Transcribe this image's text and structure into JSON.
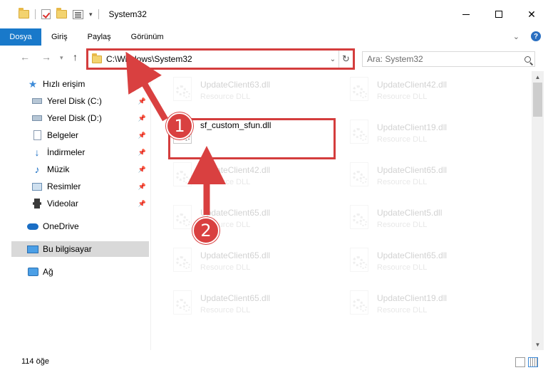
{
  "window": {
    "title": "System32"
  },
  "ribbon": {
    "tabs": [
      "Dosya",
      "Giriş",
      "Paylaş",
      "Görünüm"
    ]
  },
  "address_bar": {
    "path": "C:\\Windows\\System32"
  },
  "search": {
    "placeholder": "Ara: System32"
  },
  "sidebar": {
    "items": [
      {
        "label": "Hızlı erişim",
        "icon": "star-icon"
      },
      {
        "label": "Yerel Disk (C:)",
        "icon": "disk-icon",
        "pinned": true
      },
      {
        "label": "Yerel Disk (D:)",
        "icon": "disk-icon",
        "pinned": true
      },
      {
        "label": "Belgeler",
        "icon": "document-icon",
        "pinned": true
      },
      {
        "label": "İndirmeler",
        "icon": "download-icon",
        "pinned": true
      },
      {
        "label": "Müzik",
        "icon": "music-icon",
        "pinned": true
      },
      {
        "label": "Resimler",
        "icon": "picture-icon",
        "pinned": true
      },
      {
        "label": "Videolar",
        "icon": "video-icon",
        "pinned": true
      },
      {
        "label": "OneDrive",
        "icon": "cloud-icon"
      },
      {
        "label": "Bu bilgisayar",
        "icon": "computer-icon",
        "selected": true
      },
      {
        "label": "Ağ",
        "icon": "network-icon"
      }
    ]
  },
  "files": [
    {
      "name": "UpdateClient63.dll",
      "type": "Resource DLL",
      "faded": true
    },
    {
      "name": "UpdateClient42.dll",
      "type": "Resource DLL",
      "faded": true
    },
    {
      "name": "sf_custom_sfun.dll",
      "type": "",
      "faded": false,
      "highlighted": true
    },
    {
      "name": "UpdateClient19.dll",
      "type": "Resource DLL",
      "faded": true
    },
    {
      "name": "UpdateClient42.dll",
      "type": "Resource DLL",
      "faded": true
    },
    {
      "name": "UpdateClient65.dll",
      "type": "Resource DLL",
      "faded": true
    },
    {
      "name": "UpdateClient65.dll",
      "type": "Resource DLL",
      "faded": true
    },
    {
      "name": "UpdateClient5.dll",
      "type": "Resource DLL",
      "faded": true
    },
    {
      "name": "UpdateClient65.dll",
      "type": "Resource DLL",
      "faded": true
    },
    {
      "name": "UpdateClient65.dll",
      "type": "Resource DLL",
      "faded": true
    },
    {
      "name": "UpdateClient65.dll",
      "type": "Resource DLL",
      "faded": true
    },
    {
      "name": "UpdateClient19.dll",
      "type": "Resource DLL",
      "faded": true
    }
  ],
  "status": {
    "item_count": "114 öğe"
  },
  "annotations": {
    "step1": "1",
    "step2": "2",
    "color": "#d94040"
  }
}
